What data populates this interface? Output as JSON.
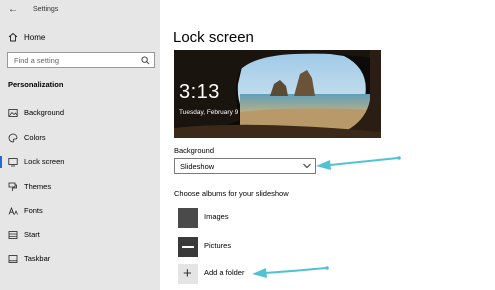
{
  "window": {
    "title": "Settings"
  },
  "sidebar": {
    "home_label": "Home",
    "search_placeholder": "Find a setting",
    "section_title": "Personalization",
    "items": [
      {
        "label": "Background",
        "icon": "image-icon"
      },
      {
        "label": "Colors",
        "icon": "palette-icon"
      },
      {
        "label": "Lock screen",
        "icon": "lock-screen-icon",
        "active": true
      },
      {
        "label": "Themes",
        "icon": "brush-icon"
      },
      {
        "label": "Fonts",
        "icon": "font-icon"
      },
      {
        "label": "Start",
        "icon": "start-icon"
      },
      {
        "label": "Taskbar",
        "icon": "taskbar-icon"
      }
    ]
  },
  "main": {
    "page_title": "Lock screen",
    "preview": {
      "time": "3:13",
      "date": "Tuesday, February 9"
    },
    "background_label": "Background",
    "background_value": "Slideshow",
    "albums_label": "Choose albums for your slideshow",
    "albums": [
      {
        "label": "Images"
      },
      {
        "label": "Pictures"
      }
    ],
    "add_folder_label": "Add a folder"
  },
  "colors": {
    "accent": "#1f6ad6",
    "annotation_arrow": "#4fc3d2",
    "sidebar_bg": "#e6e6e6"
  }
}
